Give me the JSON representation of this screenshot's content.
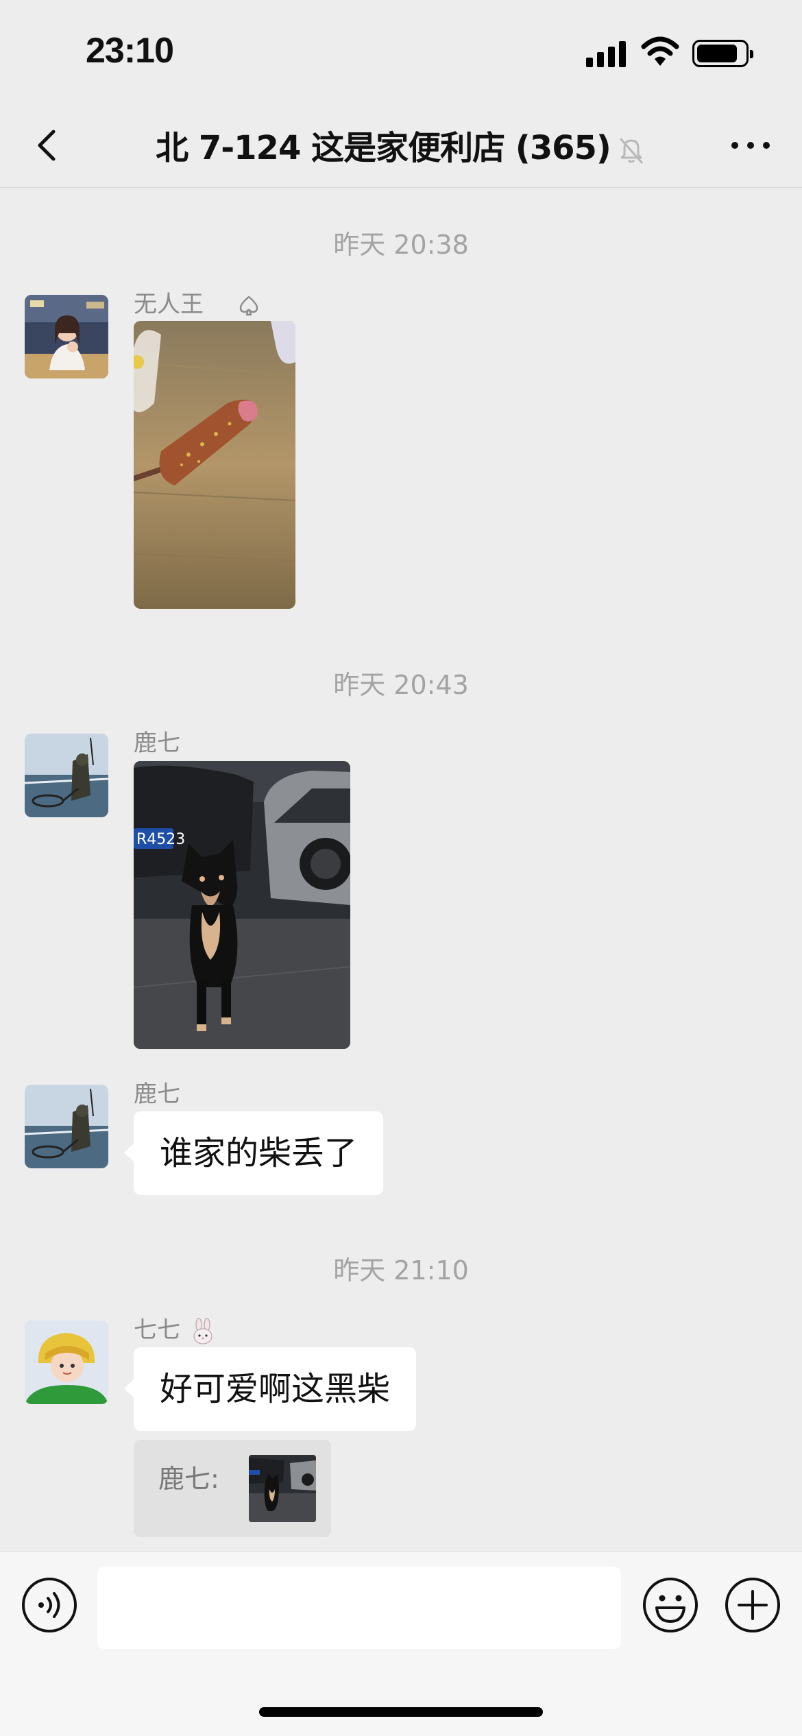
{
  "status": {
    "time": "23:10"
  },
  "nav": {
    "back_icon": "chevron-left-icon",
    "title": "北 7-124 这是家便利店 (365)",
    "mute_icon": "bell-slash-icon",
    "more_icon": "more-dots-icon"
  },
  "messages": [
    {
      "timestamp": "昨天 20:38"
    },
    {
      "sender": "无人王",
      "sender_badge_icon": "spade-icon",
      "type": "image",
      "image_desc": "sausage-on-stick-photo"
    },
    {
      "timestamp": "昨天 20:43"
    },
    {
      "sender": "鹿七",
      "type": "image",
      "image_desc": "black-shiba-dog-photo",
      "plate_text": "R4523"
    },
    {
      "sender": "鹿七",
      "type": "text",
      "text": "谁家的柴丢了"
    },
    {
      "timestamp": "昨天 21:10"
    },
    {
      "sender": "七七",
      "sender_badge_icon": "rabbit-emoji-icon",
      "type": "text",
      "text": "好可爱啊这黑柴",
      "quote": {
        "label": "鹿七:",
        "thumb": "black-shiba-dog-thumbnail"
      }
    }
  ],
  "input": {
    "voice_icon": "voice-icon",
    "emoji_icon": "emoji-icon",
    "plus_icon": "plus-circle-icon"
  },
  "colors": {
    "background": "#ededed",
    "bubble": "#ffffff",
    "timestamp": "#a3a3a3",
    "sender": "#8a8a8a"
  }
}
